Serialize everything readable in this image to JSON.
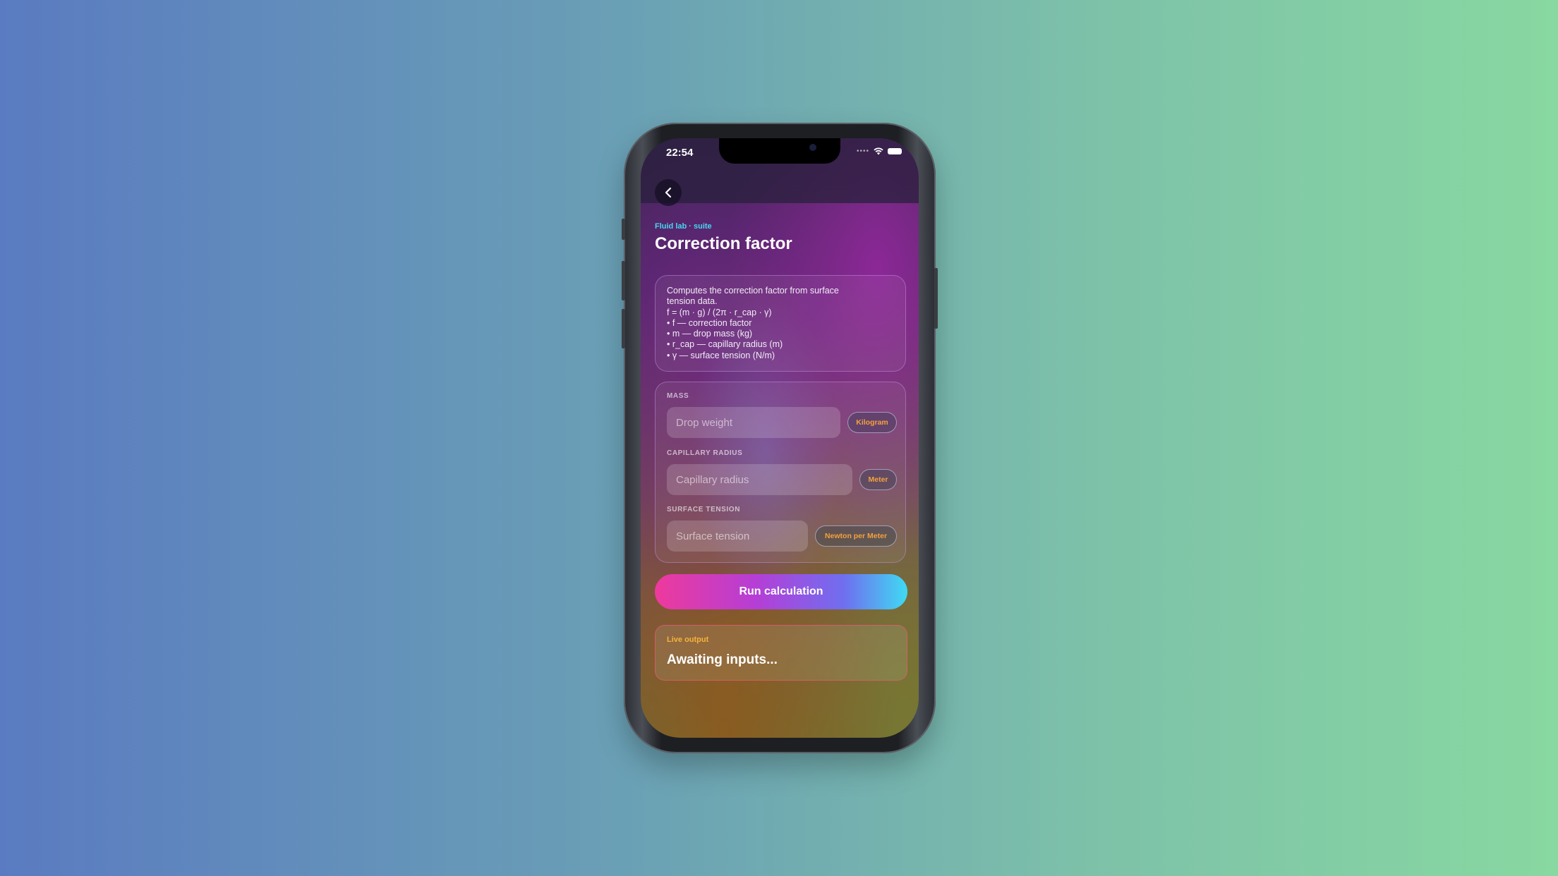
{
  "status_bar": {
    "time": "22:54",
    "signal_icon": "cellular-dots-icon",
    "wifi_icon": "wifi-icon",
    "battery_icon": "battery-icon"
  },
  "nav": {
    "back_icon": "chevron-left-icon"
  },
  "header": {
    "eyebrow": "Fluid lab · suite",
    "title": "Correction factor"
  },
  "description": {
    "lines": [
      "Computes the correction factor from surface",
      "tension data.",
      "f = (m · g) / (2π · r_cap · γ)",
      "• f — correction factor",
      "• m — drop mass (kg)",
      "• r_cap — capillary radius (m)",
      "• γ — surface tension (N/m)"
    ]
  },
  "fields": [
    {
      "label": "MASS",
      "placeholder": "Drop weight",
      "unit": "Kilogram"
    },
    {
      "label": "CAPILLARY RADIUS",
      "placeholder": "Capillary radius",
      "unit": "Meter"
    },
    {
      "label": "SURFACE TENSION",
      "placeholder": "Surface tension",
      "unit": "Newton per Meter"
    }
  ],
  "run_button": {
    "label": "Run calculation"
  },
  "output": {
    "label": "Live output",
    "value": "Awaiting inputs..."
  },
  "colors": {
    "accent_cyan": "#46d8f0",
    "accent_orange": "#f5a13c",
    "button_gradient_start": "#ee3a9c",
    "button_gradient_end": "#3fdaf2"
  }
}
